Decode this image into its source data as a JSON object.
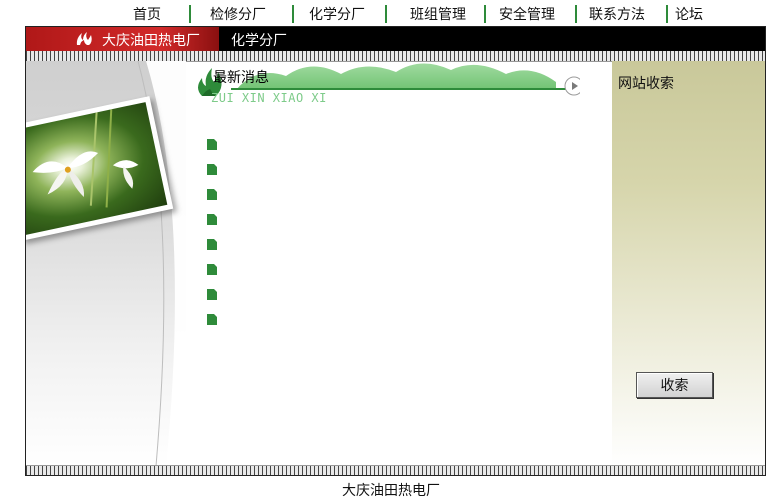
{
  "nav": {
    "items": [
      {
        "label": "首页"
      },
      {
        "label": "检修分厂"
      },
      {
        "label": "化学分厂"
      },
      {
        "label": "班组管理"
      },
      {
        "label": "安全管理"
      },
      {
        "label": "联系方法"
      },
      {
        "label": "论坛"
      }
    ]
  },
  "header": {
    "company": "大庆油田热电厂",
    "section": "化学分厂"
  },
  "news": {
    "title": "最新消息",
    "subtitle": "ZUI XIN XIAO XI",
    "item_count_bullets": 8
  },
  "sidebar": {
    "heading": "网站收索",
    "button_label": "收索"
  },
  "footer": {
    "text": "大庆油田热电厂"
  },
  "colors": {
    "nav_separator": "#2e8b3a",
    "title_red": "#c41f1f",
    "accent_green": "#2e8b3a",
    "sidebar_khaki": "#c9c89a"
  }
}
